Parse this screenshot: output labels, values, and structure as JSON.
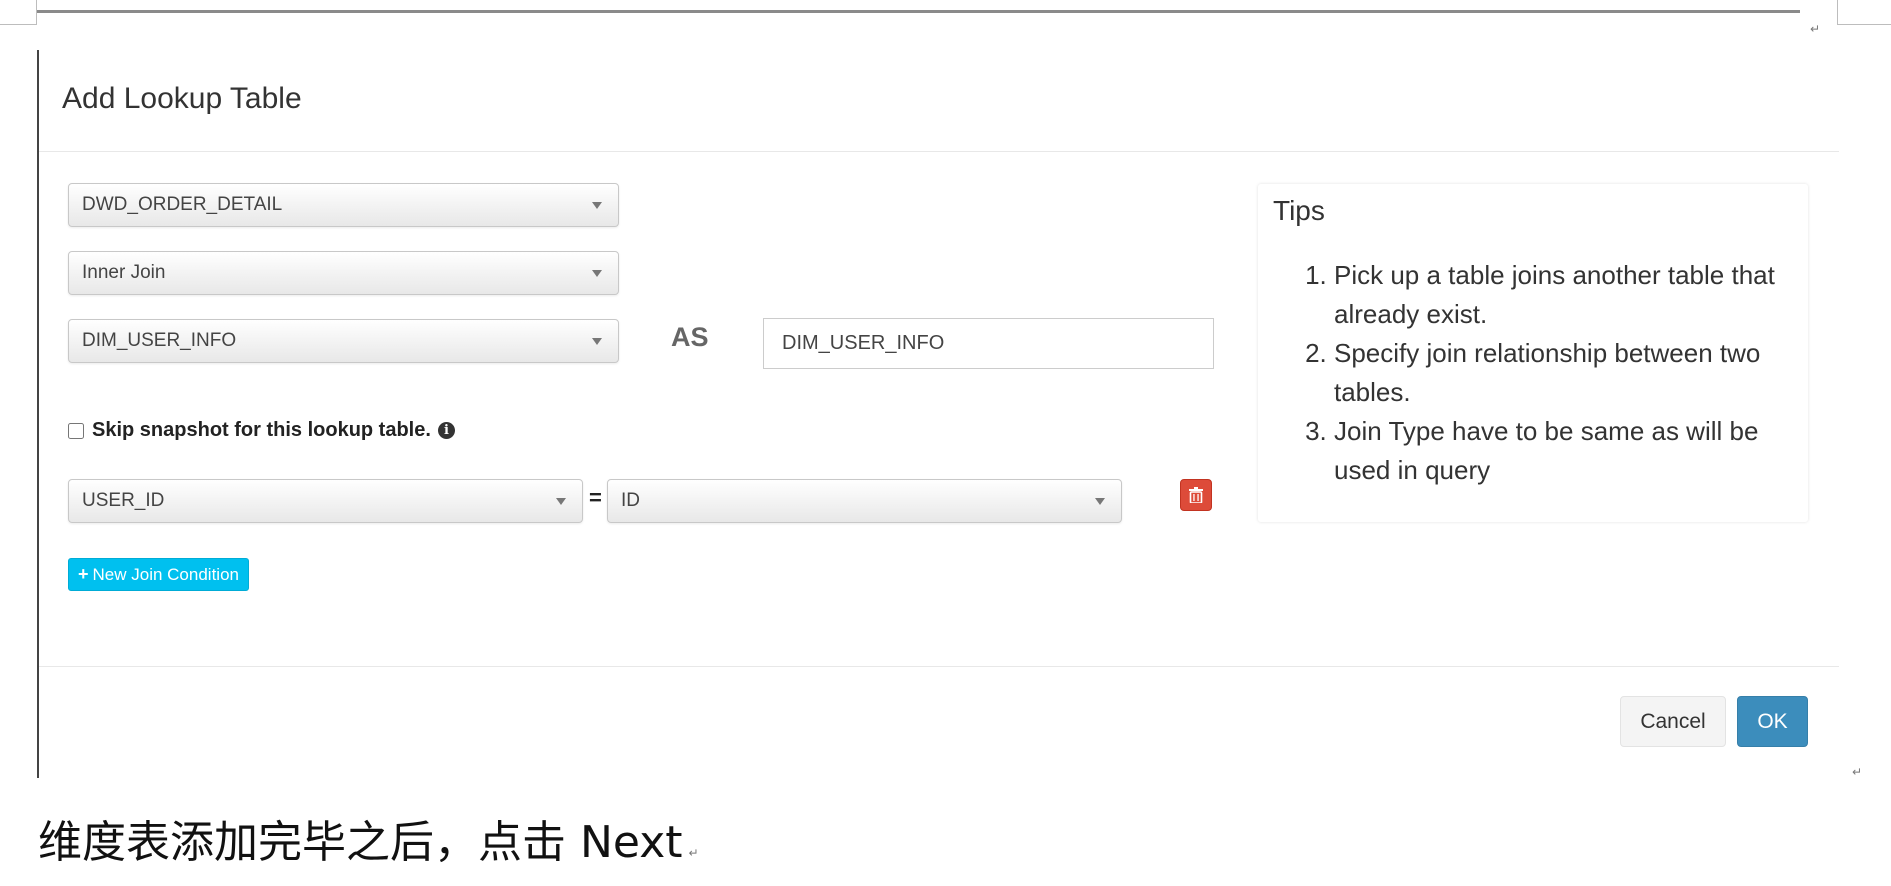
{
  "modal": {
    "title": "Add Lookup Table",
    "fact_table_select": "DWD_ORDER_DETAIL",
    "join_type_select": "Inner Join",
    "lookup_table_select": "DIM_USER_INFO",
    "as_label": "AS",
    "alias_input_value": "DIM_USER_INFO",
    "skip_snapshot_label": "Skip snapshot for this lookup table.",
    "skip_snapshot_checked": false,
    "join_condition": {
      "left_column": "USER_ID",
      "operator": "=",
      "right_column": "ID"
    },
    "new_join_condition_label": "New Join Condition",
    "tips": {
      "title": "Tips",
      "items": [
        "Pick up a table joins another table that already exist.",
        "Specify join relationship between two tables.",
        "Join Type have to be same as will be used in query"
      ]
    },
    "cancel_label": "Cancel",
    "ok_label": "OK"
  },
  "caption": "维度表添加完毕之后，点击 Next",
  "icons": {
    "info": "info-circle-icon",
    "delete": "trash-icon",
    "plus": "plus-icon",
    "dropdown": "caret-down-icon"
  },
  "colors": {
    "ok_button": "#3c8dbc",
    "new_join_button": "#00c0ef",
    "delete_button": "#dd4b39"
  }
}
